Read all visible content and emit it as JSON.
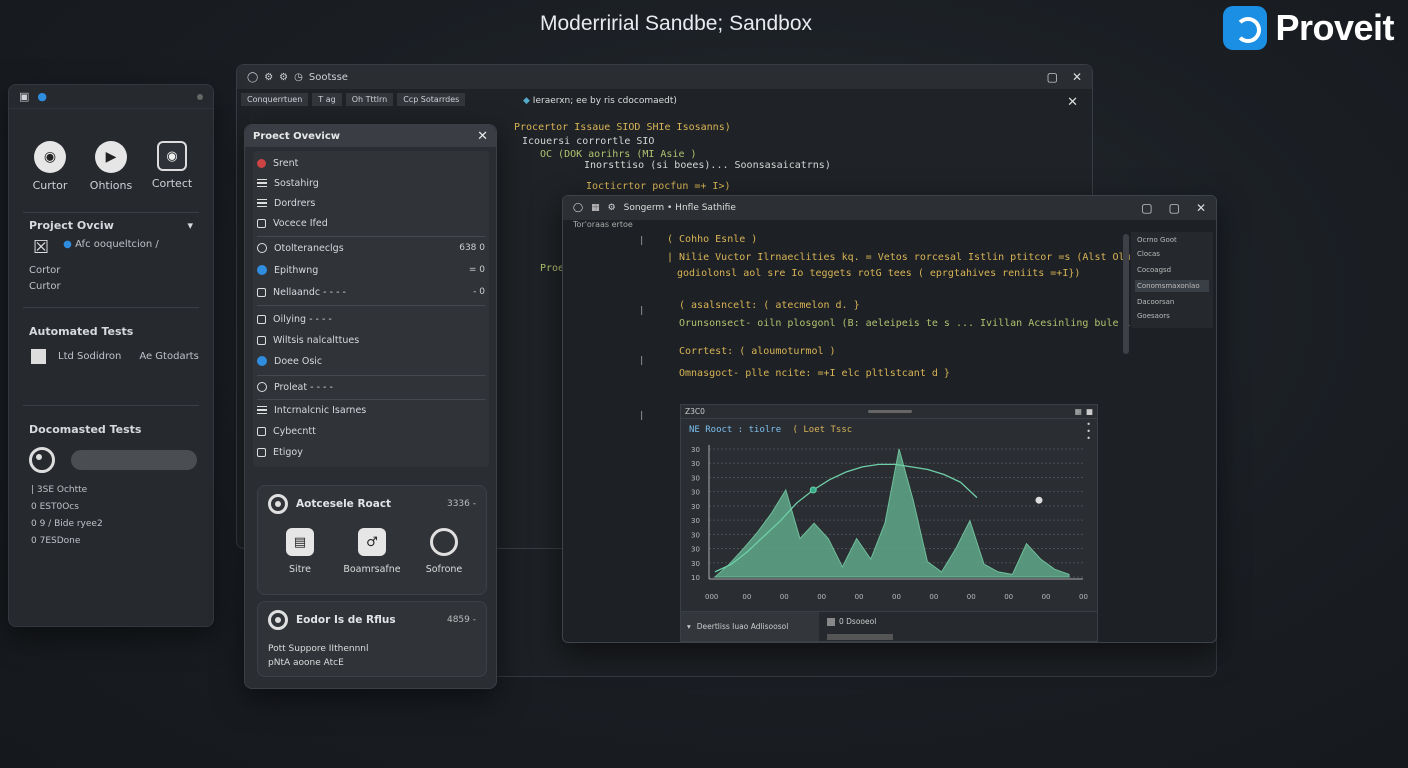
{
  "header": {
    "title": "Moderririal Sandbe; Sandbox",
    "brand": "Proveit"
  },
  "left_panel": {
    "tools": [
      {
        "label": "Curtor",
        "icon": "camera-icon"
      },
      {
        "label": "Ohtions",
        "icon": "play-icon"
      },
      {
        "label": "Cortect",
        "icon": "capture-icon"
      }
    ],
    "section1": {
      "title": "Project Ovciw",
      "item_text": "Afc ooqueltcion /",
      "label1": "Cortor",
      "label2": "Curtor"
    },
    "section2": {
      "title": "Automated Tests",
      "item1": "Ltd Sodidron",
      "item2": "Ae Gtodarts"
    },
    "section3": {
      "title": "Docomasted Tests",
      "lines": [
        "| 3SE Ochtte",
        "0 EST0Ocs",
        "0 9 / Bide ryee2",
        "0 7ESDone"
      ]
    }
  },
  "main_window": {
    "title": "Sootsse",
    "tab1": "Conquerrtuen",
    "tab2": "T ag",
    "tab3": "Oh Tttlrn",
    "tab4": "Ccp Sotarrdes",
    "tab5": "Ieraerxn; ee by ris cdocomaedt)",
    "code": [
      "Procertor  Issaue  SIOD  SHIe  Isosanns)",
      "Icouersi  corrortle  SIO",
      "OC (DOK  aorihrs  (MI Asie )",
      "Inorsttiso  (si boees)... Soonsasaicatrns)",
      "Iocticrtor  pocfun  =+ I>)",
      "Proe"
    ]
  },
  "overview": {
    "title": "Proect Ovevicw",
    "items": [
      {
        "label": "Srent",
        "val": ""
      },
      {
        "label": "Sostahirg",
        "val": ""
      },
      {
        "label": "Dordrers",
        "val": ""
      },
      {
        "label": "Vocece Ifed",
        "val": ""
      },
      {
        "label": "Otolteraneclgs",
        "val": "638 0"
      },
      {
        "label": "Epithwng",
        "val": "= 0"
      },
      {
        "label": "Nellaandc - - - -",
        "val": "- 0"
      },
      {
        "label": "Oilying - - - -",
        "val": ""
      },
      {
        "label": "Wiltsis nalcalttues",
        "val": ""
      },
      {
        "label": "Doee Osic",
        "val": ""
      },
      {
        "label": "Proleat  - - - -",
        "val": ""
      },
      {
        "label": "Intcrnalcnic Isarnes",
        "val": ""
      },
      {
        "label": "Cybecntt",
        "val": ""
      },
      {
        "label": "Etigoy",
        "val": ""
      }
    ],
    "card1": {
      "title": "Aotcesele Roact",
      "meta": "3336 -",
      "tools": [
        {
          "label": "Sitre",
          "icon": "document-icon"
        },
        {
          "label": "Boamrsafne",
          "icon": "link-icon"
        },
        {
          "label": "Sofrone",
          "icon": "target-icon"
        }
      ]
    },
    "card2": {
      "title": "Eodor Is de Rflus",
      "meta": "4859 -",
      "line1": "Pott Suppore IIthennnl",
      "line2": "pNtA aoone AtcE"
    }
  },
  "editor": {
    "title": "Songerm • Hnfle Sathifie",
    "sub": "Tor'oraas ertoe",
    "code": [
      {
        "text": "( Cohho Esnle )",
        "color": "c-yel"
      },
      {
        "text": "| Nilie Vuctor Ilrnaeclities kq. = Vetos rorcesal Istlin ptitcor =s (Alst Olurectly",
        "color": "c-yel"
      },
      {
        "text": "godiolonsl aol sre Io teggets rotG tees ( eprgtahives reniits =+I})",
        "color": "c-yel"
      },
      {
        "text": "( asalsncelt: ( atecmelon d. }",
        "color": "c-yel"
      },
      {
        "text": "Orunsonsect-  oiln  plosgonl (B: aeleipeis te  s ... Ivillan Acesinling bule locotlont",
        "color": "c-grn"
      },
      {
        "text": "Corrtest: ( aloumoturmol )",
        "color": "c-yel"
      },
      {
        "text": "Omnasgoct-  plle  ncite: =+I  elc  pltlstcant d }",
        "color": "c-yel"
      }
    ],
    "sidebar": [
      "Ocrno Goot",
      "Clocas",
      "Cocoagsd",
      "Conomsmaxonlao",
      "Dacoorsan",
      "Goesaors"
    ]
  },
  "chart_panel": {
    "tab": "Z3C0",
    "legend1": "NE  Rooct  : tiolre",
    "legend2": "( Loet Tssc",
    "bottom_left": "Deertliss Iuao Adlisoosol",
    "bottom_right": "0 Dsooeol"
  },
  "chart_data": {
    "type": "area",
    "title": "",
    "y_tick_labels": [
      "30",
      "30",
      "30",
      "30",
      "30",
      "30",
      "30",
      "30",
      "30",
      "10"
    ],
    "x_tick_labels": [
      "000",
      "00",
      "00",
      "00",
      "00",
      "00",
      "00",
      "00",
      "00",
      "00",
      "00"
    ],
    "series": [
      {
        "values": [
          0,
          10,
          22,
          35,
          50,
          68,
          30,
          42,
          30,
          8,
          30,
          14,
          42,
          100,
          60,
          12,
          4,
          22,
          44,
          10,
          4,
          2,
          26,
          14,
          6,
          2
        ]
      },
      {
        "values": [
          4,
          10,
          20,
          32,
          44,
          58,
          68,
          76,
          82,
          86,
          88,
          88,
          86,
          84,
          80,
          74,
          62
        ]
      }
    ],
    "ylim": [
      0,
      100
    ]
  }
}
